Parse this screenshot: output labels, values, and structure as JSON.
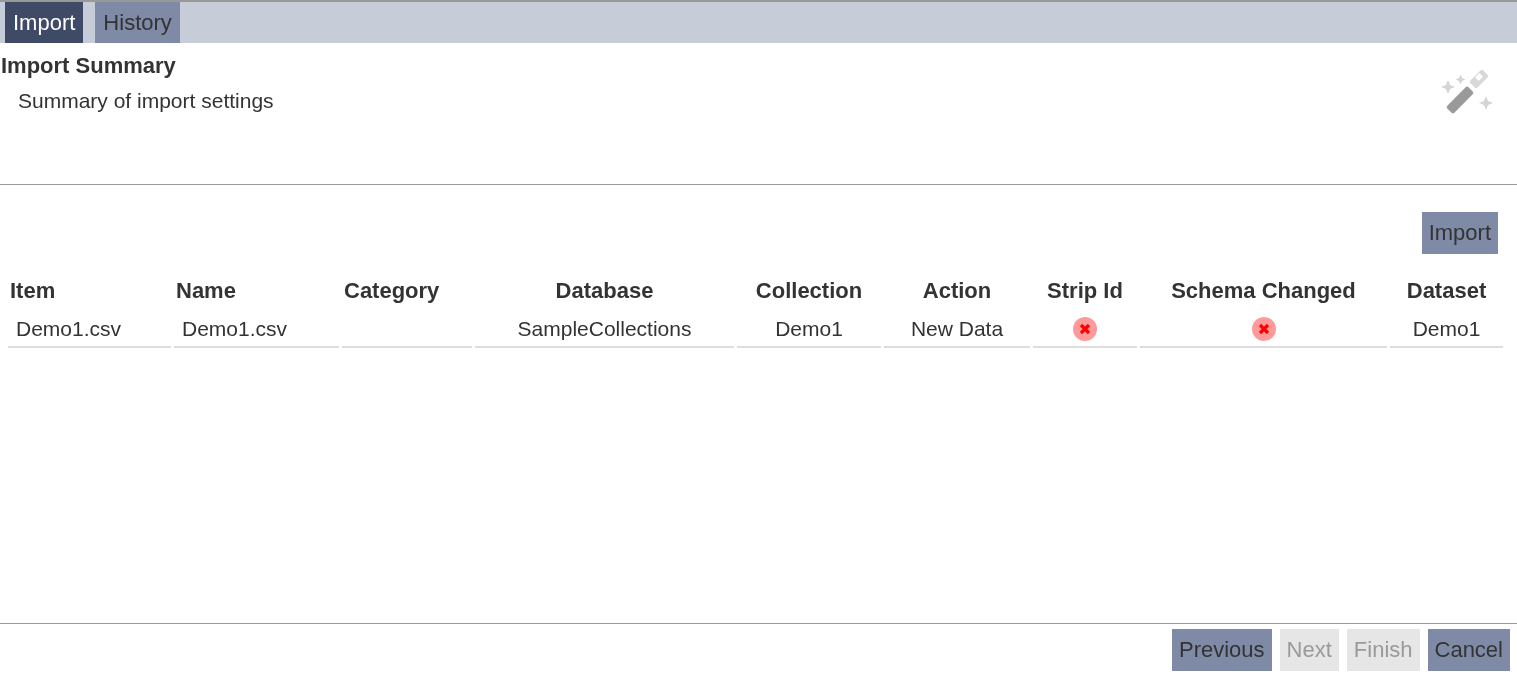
{
  "tabs": [
    {
      "label": "Import",
      "selected": true
    },
    {
      "label": "History",
      "selected": false
    }
  ],
  "header": {
    "title": "Import Summary",
    "subtitle": "Summary of import settings"
  },
  "import_button": "Import",
  "table": {
    "columns": [
      "Item",
      "Name",
      "Category",
      "Database",
      "Collection",
      "Action",
      "Strip Id",
      "Schema Changed",
      "Dataset"
    ],
    "rows": [
      [
        {
          "kind": "text",
          "text": "Demo1.csv"
        },
        {
          "kind": "text",
          "text": "Demo1.csv"
        },
        {
          "kind": "blank"
        },
        {
          "kind": "text",
          "text": "SampleCollections"
        },
        {
          "kind": "text",
          "text": "Demo1"
        },
        {
          "kind": "text",
          "text": "New Data"
        },
        {
          "kind": "flag",
          "checked": false
        },
        {
          "kind": "flag",
          "checked": false
        },
        {
          "kind": "text",
          "text": "Demo1"
        }
      ]
    ]
  },
  "footer_buttons": [
    {
      "label": "Previous",
      "disabled": false
    },
    {
      "label": "Next",
      "disabled": true
    },
    {
      "label": "Finish",
      "disabled": true
    },
    {
      "label": "Cancel",
      "disabled": false
    }
  ]
}
